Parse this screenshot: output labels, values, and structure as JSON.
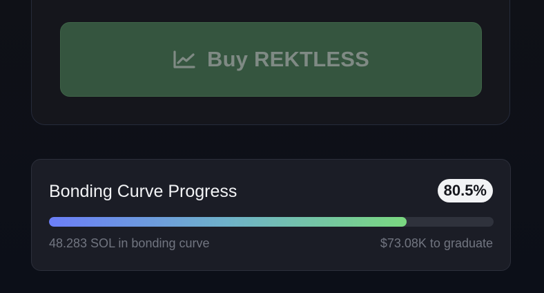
{
  "buy": {
    "button_label": "Buy REKTLESS",
    "icon": "chart-line-icon"
  },
  "bonding_curve": {
    "title": "Bonding Curve Progress",
    "percent_label": "80.5%",
    "progress_fraction": 0.805,
    "sol_text": "48.283 SOL in bonding curve",
    "graduate_text": "$73.08K to graduate"
  },
  "colors": {
    "background": "#0f1117",
    "button": "#35553f",
    "progress_start": "#6b7ef8",
    "progress_end": "#7ad880"
  }
}
